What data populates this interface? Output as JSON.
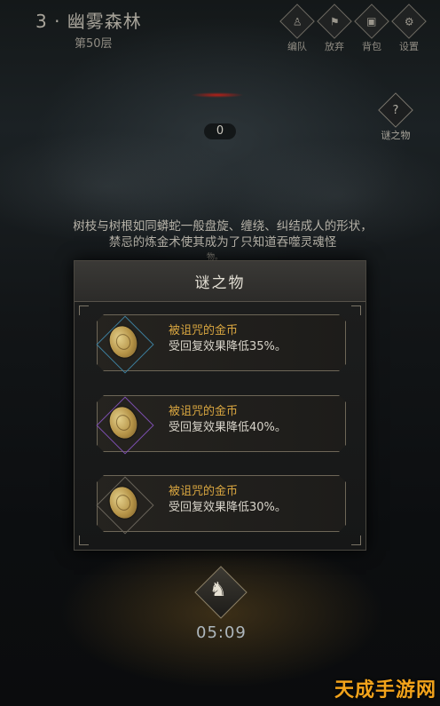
{
  "header": {
    "floor_title": "3 · 幽雾森林",
    "floor_sub": "第50层",
    "buttons": [
      {
        "label": "编队",
        "icon": "team-icon",
        "glyph": "♙"
      },
      {
        "label": "放弃",
        "icon": "abandon-icon",
        "glyph": "⚑"
      },
      {
        "label": "背包",
        "icon": "backpack-icon",
        "glyph": "▣"
      },
      {
        "label": "设置",
        "icon": "settings-icon",
        "glyph": "⚙"
      }
    ]
  },
  "riddle_button": {
    "label": "谜之物",
    "icon": "riddle-icon",
    "glyph": "?"
  },
  "counter": "0",
  "story": {
    "text": "树枝与树根如同蟒蛇一般盘旋、缠绕、纠结成人的形状，禁忌的炼金术使其成为了只知道吞噬灵魂怪",
    "line3": "物。"
  },
  "modal": {
    "title": "谜之物",
    "items": [
      {
        "name": "被诅咒的金币",
        "desc": "受回复效果降低35%。",
        "frame": "blue"
      },
      {
        "name": "被诅咒的金币",
        "desc": "受回复效果降低40%。",
        "frame": "purple"
      },
      {
        "name": "被诅咒的金币",
        "desc": "受回复效果降低30%。",
        "frame": "plain"
      }
    ]
  },
  "timer": "05:09",
  "watermark": "天成手游网",
  "colors": {
    "item_name": "#d9a640",
    "watermark": "#f2a31b",
    "blue_frame": "#3d7f9e",
    "purple_frame": "#7d4fb0"
  }
}
